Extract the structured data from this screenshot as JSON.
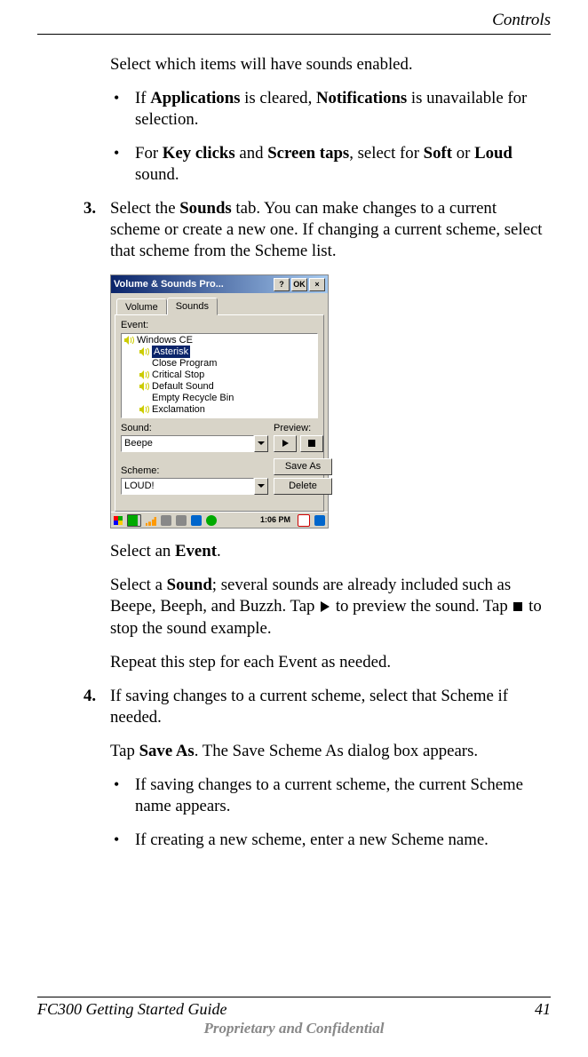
{
  "header": {
    "section": "Controls"
  },
  "intro": "Select which items will have sounds enabled.",
  "b1": {
    "pre": "If ",
    "k1": "Applications",
    "mid": " is cleared, ",
    "k2": "Notifications",
    "post": " is unavailable for selection."
  },
  "b2": {
    "pre": "For ",
    "k1": "Key clicks",
    "mid": " and ",
    "k2": "Screen taps",
    "mid2": ", select for ",
    "k3": "Soft",
    "mid3": " or ",
    "k4": "Loud",
    "post": " sound."
  },
  "step3": {
    "num": "3.",
    "pre": "Select the ",
    "k1": "Sounds",
    "post": " tab. You can make changes to a current scheme or create a new one. If changing a current scheme, select that scheme from the Scheme list."
  },
  "win": {
    "title": "Volume & Sounds Pro...",
    "btn_help": "?",
    "btn_ok": "OK",
    "btn_close": "×",
    "tab_volume": "Volume",
    "tab_sounds": "Sounds",
    "label_event": "Event:",
    "events": [
      "Windows CE",
      "Asterisk",
      "Close Program",
      "Critical Stop",
      "Default Sound",
      "Empty Recycle Bin",
      "Exclamation"
    ],
    "label_sound": "Sound:",
    "sound_value": "Beepe",
    "label_preview": "Preview:",
    "label_scheme": "Scheme:",
    "scheme_value": "LOUD!",
    "btn_saveas": "Save As",
    "btn_delete": "Delete",
    "clock": "1:06 PM"
  },
  "selectEvent": {
    "pre": "Select an ",
    "k1": "Event",
    "post": "."
  },
  "selectSound": {
    "pre": "Select a ",
    "k1": "Sound",
    "mid": "; several sounds are already included such as Beepe, Beeph, and Buzzh. Tap ",
    "mid2": " to preview the sound. Tap ",
    "post": " to stop the sound example."
  },
  "repeat": "Repeat this step for each Event as needed.",
  "step4": {
    "num": "4.",
    "text": "If saving changes to a current scheme, select that Scheme if needed."
  },
  "saveAs": {
    "pre": "Tap ",
    "k1": "Save As",
    "post": ". The Save Scheme As dialog box appears."
  },
  "b3": "If saving changes to a current scheme, the current Scheme name appears.",
  "b4": "If creating a new scheme, enter a new Scheme name.",
  "footer": {
    "left": "FC300  Getting Started Guide",
    "right": "41",
    "center": "Proprietary and Confidential"
  }
}
